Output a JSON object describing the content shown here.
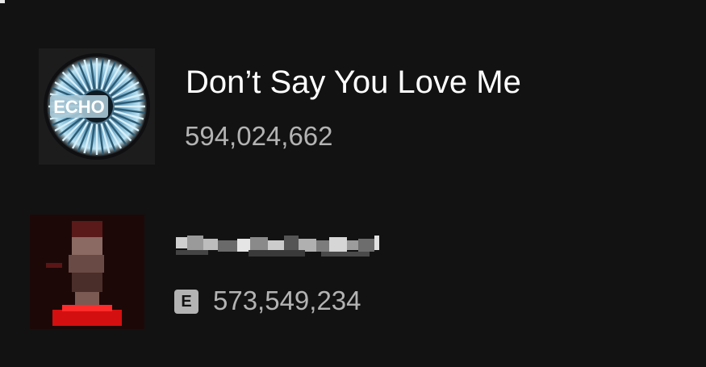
{
  "tracks": [
    {
      "title": "Don’t Say You Love Me",
      "plays": "594,024,662",
      "explicit": false,
      "cover_text": "ECHO",
      "cover_colors": {
        "primary": "#6fa9c9",
        "ring": "#b8e0f0",
        "dark": "#0f0f12"
      }
    },
    {
      "title": "",
      "title_obscured": true,
      "plays": "573,549,234",
      "explicit": true,
      "explicit_label": "E",
      "cover_colors": {
        "primary": "#3a0c0c",
        "accent": "#e01010"
      }
    }
  ],
  "colors": {
    "background": "#121212",
    "title": "#ffffff",
    "secondary_text": "#b3b3b3"
  }
}
